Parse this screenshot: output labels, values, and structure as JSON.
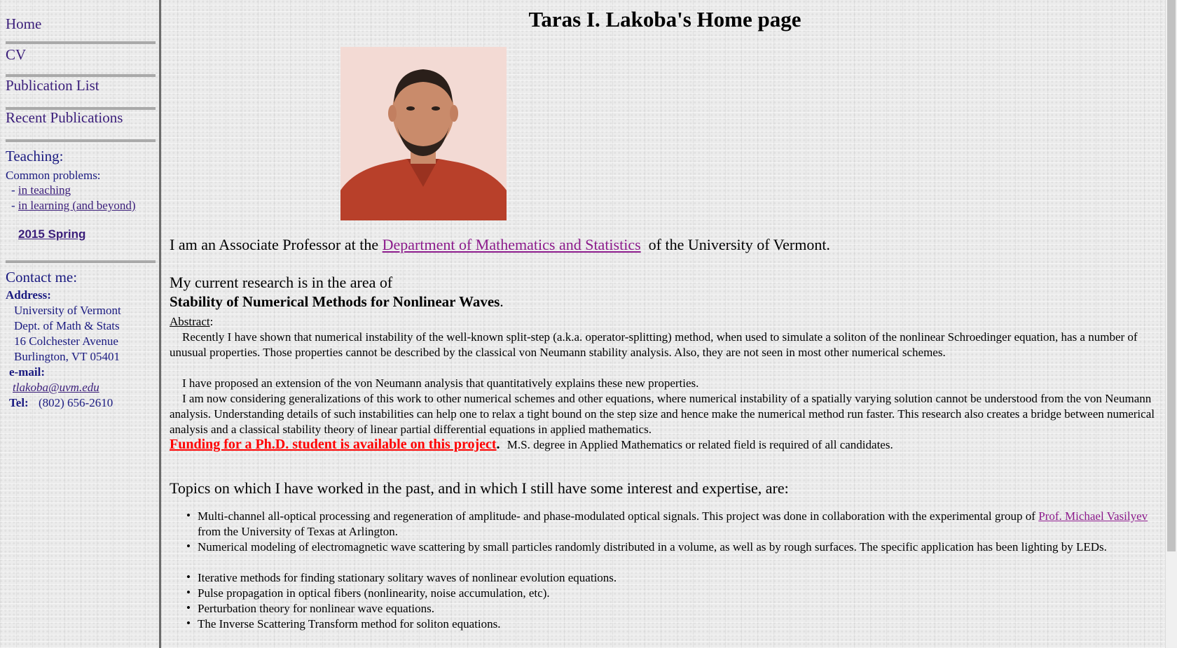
{
  "nav": {
    "home": "Home",
    "cv": "CV",
    "publication_list": "Publication List",
    "recent_publications": "Recent Publications",
    "teaching_heading": "Teaching:",
    "common_problems": "Common problems:",
    "dash1": "- ",
    "in_teaching": "in teaching",
    "dash2": "- ",
    "in_learning": "in learning (and beyond)",
    "semester": "2015 Spring",
    "contact_heading": "Contact me:",
    "address_label": "Address:",
    "address_lines": [
      "University of Vermont",
      "Dept. of Math & Stats",
      "16 Colchester Avenue",
      "Burlington, VT 05401"
    ],
    "email_label": "e-mail:",
    "email": "tlakoba@uvm.edu",
    "tel_label": "Tel:",
    "tel": "(802) 656-2610"
  },
  "main": {
    "title": "Taras I. Lakoba's Home page",
    "intro_pre": "I am an Associate Professor at the ",
    "intro_link": "Department of Mathematics and Statistics",
    "intro_post": "  of the University of Vermont.",
    "research_pre": "My current research is in the area of",
    "research_topic": "Stability of Numerical Methods for Nonlinear Waves",
    "research_dot": ".",
    "abstract_label": "Abstract",
    "abstract_colon": ":",
    "abstract_p1": "Recently I have shown that numerical instability of the well-known split-step (a.k.a. operator-splitting) method, when used to simulate a soliton of the nonlinear Schroedinger equation, has a number of unusual properties. Those properties cannot be described by the classical von Neumann stability analysis. Also, they are not seen in most other numerical schemes.",
    "abstract_p2": "I have proposed an extension of the von Neumann analysis that quantitatively explains these new properties.",
    "abstract_p3": "I am now considering generalizations of this work to other numerical schemes and other equations, where numerical instability of a spatially varying solution cannot be understood from the von Neumann analysis. Understanding details of such instabilities can help one to relax a tight bound on the step size and hence make the numerical method run faster. This research also creates a bridge between numerical analysis and a classical stability theory of linear partial differential equations in applied mathematics.",
    "funding_link": "Funding for a Ph.D. student is available on this project",
    "funding_period": ".",
    "funding_note": "M.S. degree in Applied Mathematics or related field is required of all candidates.",
    "topics_heading": "Topics on which I have worked in the past, and in which I still have some interest and expertise, are:",
    "topic1_pre": "Multi-channel all-optical processing and regeneration of amplitude- and phase-modulated optical signals. This project was done in collaboration with the experimental group of ",
    "topic1_link": "Prof. Michael Vasilyev",
    "topic1_post": " from the University of Texas at Arlington.",
    "topic2": "Numerical modeling of electromagnetic wave scattering by small particles randomly distributed in a volume, as well as by rough surfaces.  The specific application has been lighting by LEDs.",
    "topic3": "Iterative methods for finding stationary solitary waves of nonlinear evolution equations.",
    "topic4": "Pulse propagation in optical fibers (nonlinearity, noise accumulation, etc).",
    "topic5": "Perturbation theory for nonlinear wave equations.",
    "topic6": "The Inverse Scattering Transform method for soliton equations."
  },
  "colors": {
    "link": "#3a1d7a",
    "visited_link": "#8b1a8b",
    "funding": "#ff0000",
    "nav_text": "#1a1a80"
  }
}
